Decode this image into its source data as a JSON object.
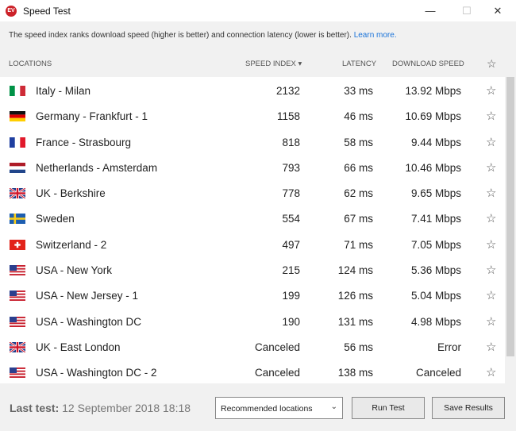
{
  "window": {
    "title": "Speed Test",
    "app_icon_text": "EV",
    "minimize_glyph": "—",
    "maximize_glyph": "☐",
    "close_glyph": "✕"
  },
  "info": {
    "text": "The speed index ranks download speed (higher is better) and connection latency (lower is better). ",
    "link": "Learn more."
  },
  "columns": {
    "locations": "LOCATIONS",
    "speed_index": "SPEED INDEX ▾",
    "latency": "LATENCY",
    "download": "DOWNLOAD SPEED",
    "favorite_icon": "☆"
  },
  "rows": [
    {
      "flag": "it",
      "location": "Italy - Milan",
      "speed": "2132",
      "latency": "33 ms",
      "download": "13.92 Mbps",
      "star": "☆"
    },
    {
      "flag": "de",
      "location": "Germany - Frankfurt - 1",
      "speed": "1158",
      "latency": "46 ms",
      "download": "10.69 Mbps",
      "star": "☆"
    },
    {
      "flag": "fr",
      "location": "France - Strasbourg",
      "speed": "818",
      "latency": "58 ms",
      "download": "9.44 Mbps",
      "star": "☆"
    },
    {
      "flag": "nl",
      "location": "Netherlands - Amsterdam",
      "speed": "793",
      "latency": "66 ms",
      "download": "10.46 Mbps",
      "star": "☆"
    },
    {
      "flag": "uk",
      "location": "UK - Berkshire",
      "speed": "778",
      "latency": "62 ms",
      "download": "9.65 Mbps",
      "star": "☆"
    },
    {
      "flag": "se",
      "location": "Sweden",
      "speed": "554",
      "latency": "67 ms",
      "download": "7.41 Mbps",
      "star": "☆"
    },
    {
      "flag": "ch",
      "location": "Switzerland - 2",
      "speed": "497",
      "latency": "71 ms",
      "download": "7.05 Mbps",
      "star": "☆"
    },
    {
      "flag": "us",
      "location": "USA - New York",
      "speed": "215",
      "latency": "124 ms",
      "download": "5.36 Mbps",
      "star": "☆"
    },
    {
      "flag": "us",
      "location": "USA - New Jersey - 1",
      "speed": "199",
      "latency": "126 ms",
      "download": "5.04 Mbps",
      "star": "☆"
    },
    {
      "flag": "us",
      "location": "USA - Washington DC",
      "speed": "190",
      "latency": "131 ms",
      "download": "4.98 Mbps",
      "star": "☆"
    },
    {
      "flag": "uk",
      "location": "UK - East London",
      "speed": "Canceled",
      "latency": "56 ms",
      "download": "Error",
      "star": "☆"
    },
    {
      "flag": "us",
      "location": "USA - Washington DC - 2",
      "speed": "Canceled",
      "latency": "138 ms",
      "download": "Canceled",
      "star": "☆"
    }
  ],
  "footer": {
    "last_test_label": "Last test:",
    "last_test_value": " 12 September 2018 18:18",
    "dropdown_value": "Recommended locations",
    "dropdown_chevron": "⌄",
    "run_button": "Run Test",
    "save_button": "Save Results"
  },
  "colors": {
    "accent": "#cc2229",
    "link": "#1a73d9",
    "panel": "#f1f1f1"
  }
}
